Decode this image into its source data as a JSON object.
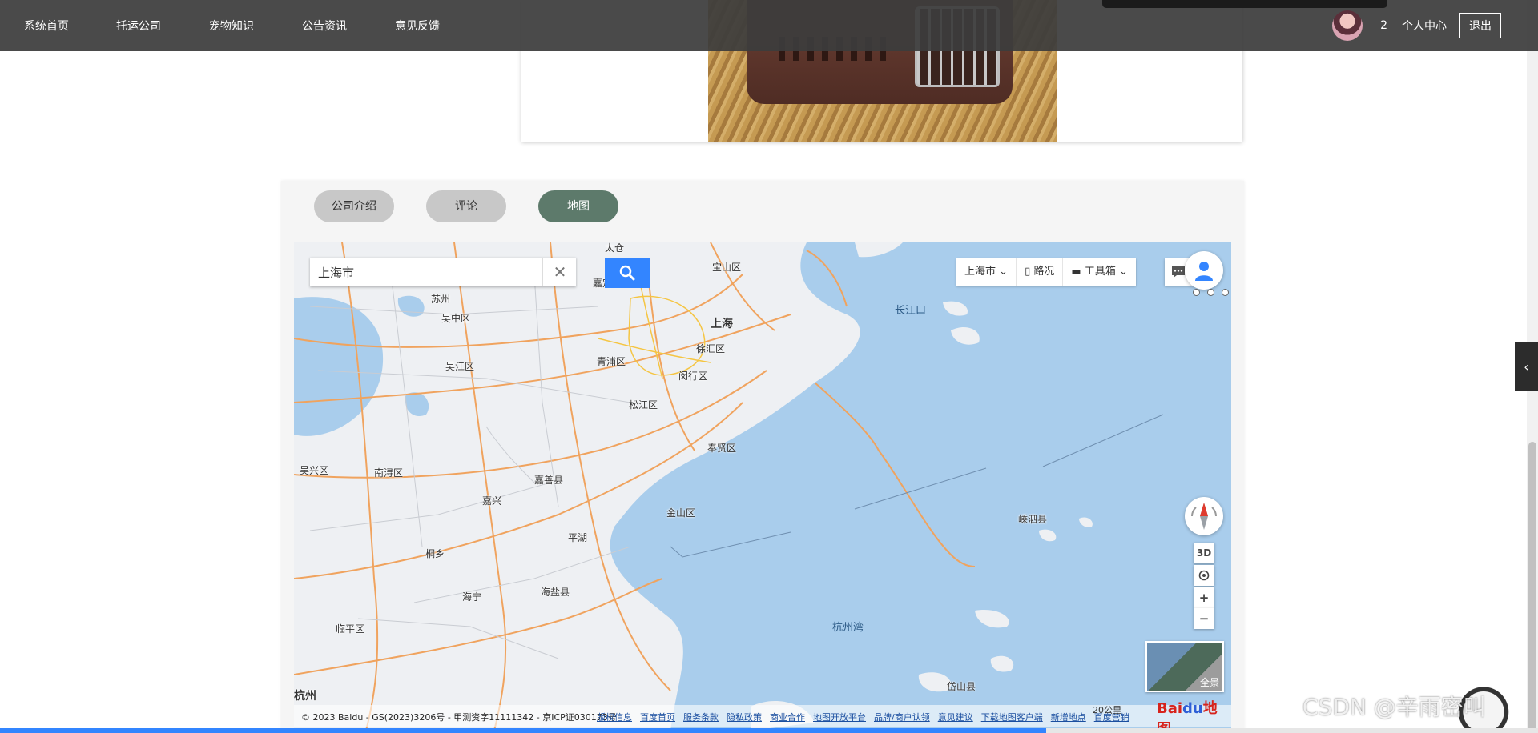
{
  "nav": {
    "items": [
      {
        "label": "系统首页"
      },
      {
        "label": "托运公司"
      },
      {
        "label": "宠物知识"
      },
      {
        "label": "公告资讯"
      },
      {
        "label": "意见反馈"
      }
    ],
    "cart_count": "2",
    "profile_label": "个人中心",
    "logout_label": "退出"
  },
  "tabs": [
    {
      "label": "公司介绍",
      "active": false
    },
    {
      "label": "评论",
      "active": false
    },
    {
      "label": "地图",
      "active": true
    }
  ],
  "map": {
    "search_value": "上海市",
    "toolbar": {
      "city": "上海市",
      "traffic": "路况",
      "toolbox": "工具箱"
    },
    "controls": {
      "three_d": "3D",
      "zoom_in": "+",
      "zoom_out": "−"
    },
    "panorama_label": "全景",
    "places": [
      {
        "name": "太仓"
      },
      {
        "name": "宝山区"
      },
      {
        "name": "嘉定区"
      },
      {
        "name": "苏州"
      },
      {
        "name": "吴中区"
      },
      {
        "name": "上海"
      },
      {
        "name": "长江口"
      },
      {
        "name": "徐汇区"
      },
      {
        "name": "青浦区"
      },
      {
        "name": "吴江区"
      },
      {
        "name": "闵行区"
      },
      {
        "name": "松江区"
      },
      {
        "name": "奉贤区"
      },
      {
        "name": "吴兴区"
      },
      {
        "name": "南浔区"
      },
      {
        "name": "嘉善县"
      },
      {
        "name": "嘉兴"
      },
      {
        "name": "金山区"
      },
      {
        "name": "平湖"
      },
      {
        "name": "嵊泗县"
      },
      {
        "name": "桐乡"
      },
      {
        "name": "海宁"
      },
      {
        "name": "海盐县"
      },
      {
        "name": "杭州湾"
      },
      {
        "name": "临平区"
      },
      {
        "name": "岱山县"
      },
      {
        "name": "杭州"
      }
    ],
    "copyright": "© 2023 Baidu - GS(2023)3206号 - 甲测资字11111342 - 京ICP证030173号",
    "links": [
      "版权信息",
      "百度首页",
      "服务条款",
      "隐私政策",
      "商业合作",
      "地图开放平台",
      "品牌/商户认领",
      "意见建议",
      "下载地图客户端",
      "新增地点",
      "百度营销"
    ],
    "scale": "20公里",
    "logo_text_a": "Bai",
    "logo_text_b": "du",
    "logo_text_c": "地图"
  },
  "watermark": "CSDN @辛雨密叫",
  "page_load_progress": 0.68,
  "colors": {
    "nav_bg": "#3c3c3c",
    "tab_active": "#5d7a6b",
    "tab_inactive": "#c8c8c8",
    "map_water": "#a9cdec",
    "map_land": "#eef0f3",
    "search_button": "#3385ff"
  },
  "icons": {
    "search": "search-icon",
    "clear": "close-icon",
    "message": "message-icon",
    "user": "user-icon",
    "compass": "compass-icon",
    "locate": "locate-icon",
    "collapse": "chevron-left-icon"
  }
}
